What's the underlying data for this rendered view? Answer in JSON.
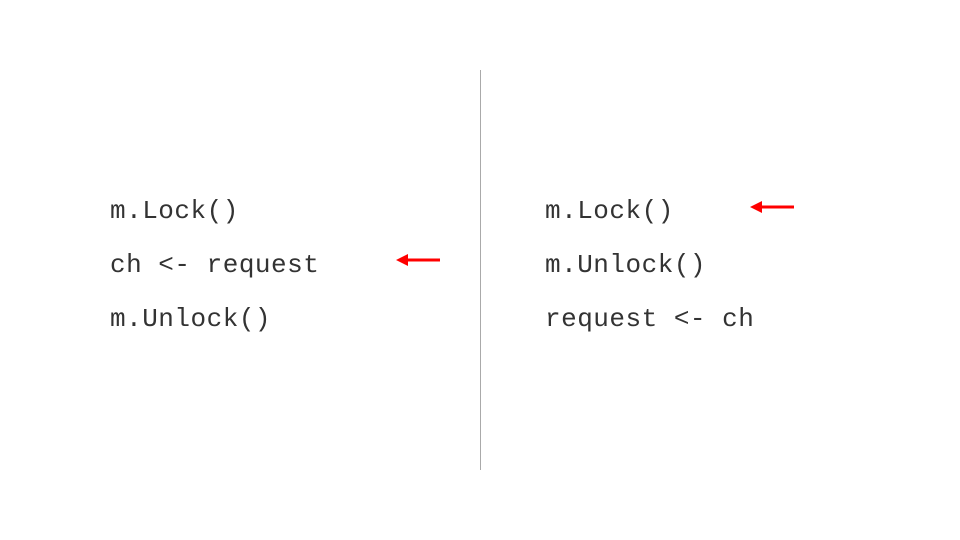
{
  "left": {
    "lines": [
      "m.Lock()",
      "ch <- request",
      "m.Unlock()"
    ]
  },
  "right": {
    "lines": [
      "m.Lock()",
      "m.Unlock()",
      "request <- ch"
    ]
  },
  "arrow_color": "#ff0000"
}
